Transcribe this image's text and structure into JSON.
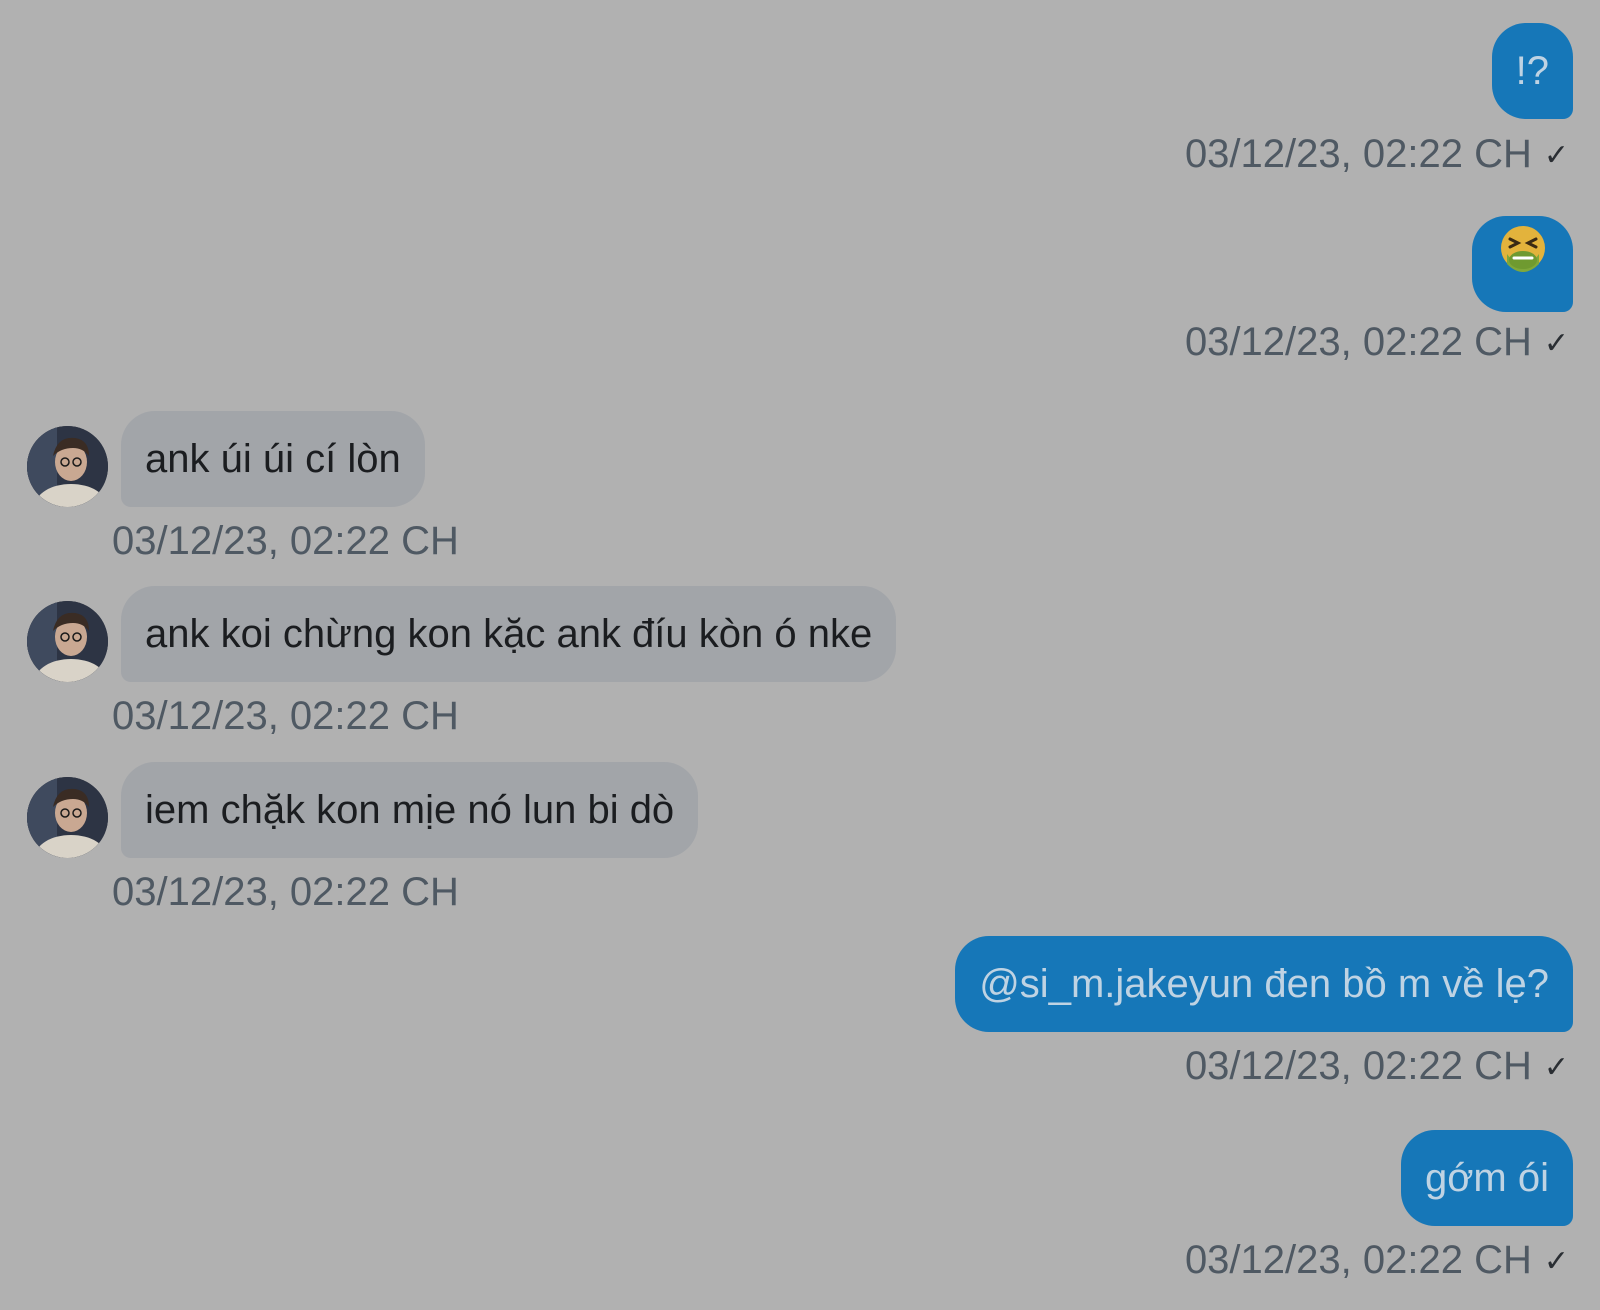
{
  "messages": [
    {
      "direction": "outgoing",
      "text": "!?",
      "time": "03/12/23, 02:22 CH",
      "status": "✓"
    },
    {
      "direction": "outgoing",
      "text": "",
      "emoji": "nauseated-face-emoji",
      "time": "03/12/23, 02:22 CH",
      "status": "✓"
    },
    {
      "direction": "incoming",
      "text": "ank úi úi cí lòn",
      "time": "03/12/23, 02:22 CH"
    },
    {
      "direction": "incoming",
      "text": "ank koi chừng kon kặc ank đíu kòn ó nke",
      "time": "03/12/23, 02:22 CH"
    },
    {
      "direction": "incoming",
      "text": "iem chặk kon mịe nó lun bi dò",
      "time": "03/12/23, 02:22 CH"
    },
    {
      "direction": "outgoing",
      "text": "@si_m.jakeyun đen bồ m về lẹ?",
      "time": "03/12/23, 02:22 CH",
      "status": "✓"
    },
    {
      "direction": "outgoing",
      "text": "gớm ói",
      "time": "03/12/23, 02:22 CH",
      "status": "✓"
    }
  ],
  "colors": {
    "background": "#b1b1b1",
    "outgoing_bubble": "#1677b8",
    "outgoing_text": "#bfd3e3",
    "incoming_bubble": "#a2a5a9",
    "incoming_text": "#1b1d20",
    "timestamp": "#4f5963"
  }
}
